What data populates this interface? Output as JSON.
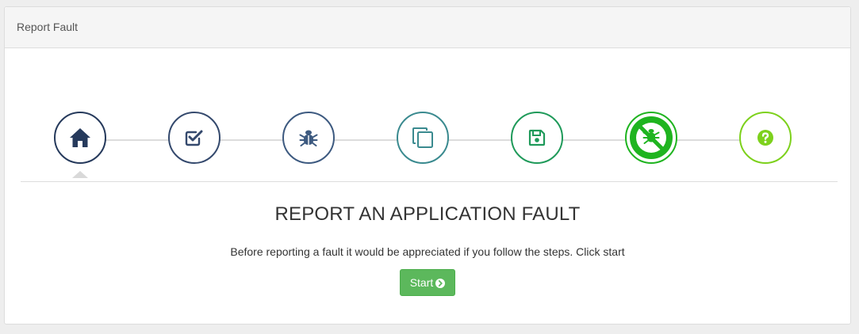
{
  "panel": {
    "heading": "Report Fault"
  },
  "steps": [
    {
      "name": "home",
      "icon": "home-icon",
      "color": "#263a5c"
    },
    {
      "name": "checklist",
      "icon": "check-square-icon",
      "color": "#34496d"
    },
    {
      "name": "bug",
      "icon": "bug-icon",
      "color": "#3d5a80"
    },
    {
      "name": "copy",
      "icon": "copy-icon",
      "color": "#3a8a8f"
    },
    {
      "name": "save",
      "icon": "save-icon",
      "color": "#1f9a5a"
    },
    {
      "name": "no-bug",
      "icon": "no-bug-icon",
      "color": "#1fb420"
    },
    {
      "name": "help",
      "icon": "question-circle-icon",
      "color": "#7dd11c"
    }
  ],
  "active_step": "home",
  "content": {
    "title": "REPORT AN APPLICATION FAULT",
    "subtitle": "Before reporting a fault it would be appreciated if you follow the steps. Click start",
    "start_label": "Start"
  },
  "colors": {
    "start_button": "#5cb85c",
    "connector_line": "#dcdcdc"
  }
}
